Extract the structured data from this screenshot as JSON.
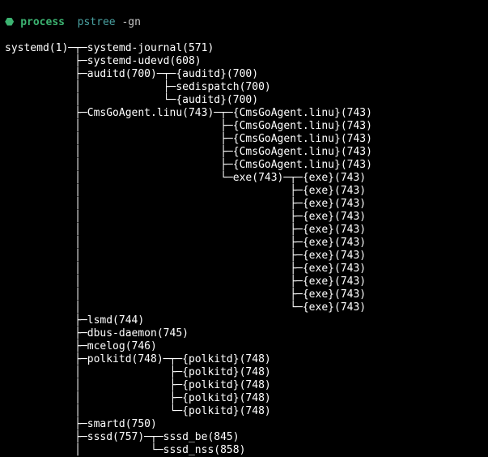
{
  "prompt": {
    "icon": "⬣",
    "label": "process",
    "command": "pstree",
    "args": "-gn"
  },
  "tree_lines": [
    "systemd(1)─┬─systemd-journal(571)",
    "           ├─systemd-udevd(608)",
    "           ├─auditd(700)─┬─{auditd}(700)",
    "           │             ├─sedispatch(700)",
    "           │             └─{auditd}(700)",
    "           ├─CmsGoAgent.linu(743)─┬─{CmsGoAgent.linu}(743)",
    "           │                      ├─{CmsGoAgent.linu}(743)",
    "           │                      ├─{CmsGoAgent.linu}(743)",
    "           │                      ├─{CmsGoAgent.linu}(743)",
    "           │                      ├─{CmsGoAgent.linu}(743)",
    "           │                      └─exe(743)─┬─{exe}(743)",
    "           │                                 ├─{exe}(743)",
    "           │                                 ├─{exe}(743)",
    "           │                                 ├─{exe}(743)",
    "           │                                 ├─{exe}(743)",
    "           │                                 ├─{exe}(743)",
    "           │                                 ├─{exe}(743)",
    "           │                                 ├─{exe}(743)",
    "           │                                 ├─{exe}(743)",
    "           │                                 ├─{exe}(743)",
    "           │                                 └─{exe}(743)",
    "           ├─lsmd(744)",
    "           ├─dbus-daemon(745)",
    "           ├─mcelog(746)",
    "           ├─polkitd(748)─┬─{polkitd}(748)",
    "           │              ├─{polkitd}(748)",
    "           │              ├─{polkitd}(748)",
    "           │              ├─{polkitd}(748)",
    "           │              └─{polkitd}(748)",
    "           ├─smartd(750)",
    "           ├─sssd(757)─┬─sssd_be(845)",
    "           │           └─sssd_nss(858)"
  ]
}
